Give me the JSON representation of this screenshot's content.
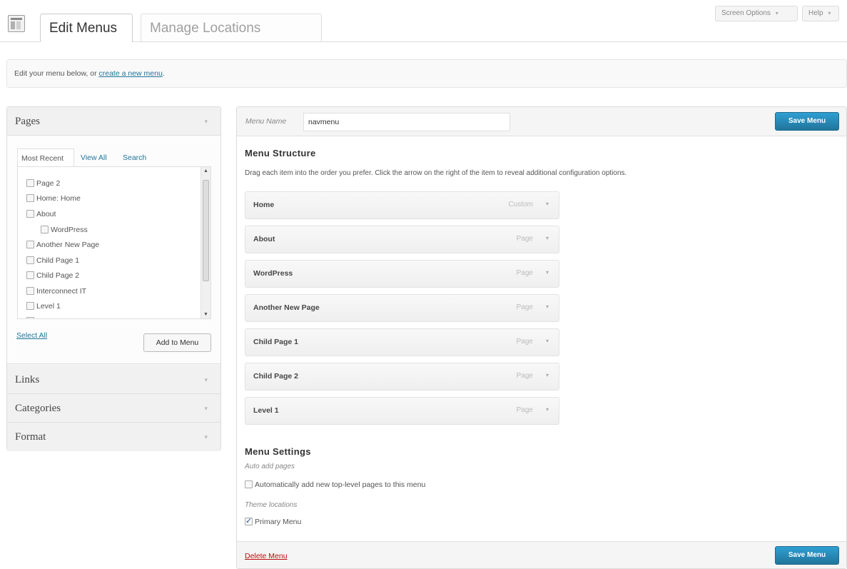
{
  "header": {
    "tabs": [
      {
        "label": "Edit Menus",
        "active": true
      },
      {
        "label": "Manage Locations",
        "active": false
      }
    ],
    "screen_options_label": "Screen Options",
    "help_label": "Help",
    "dropdown_glyph": "▾"
  },
  "notice": {
    "text": "Edit your menu below, or ",
    "link": "create a new menu",
    "suffix": "."
  },
  "sidebar": {
    "sections": [
      {
        "title": "Pages",
        "expanded": true
      },
      {
        "title": "Links",
        "expanded": false
      },
      {
        "title": "Categories",
        "expanded": false
      },
      {
        "title": "Format",
        "expanded": false
      }
    ],
    "pages_tabs": [
      "Most Recent",
      "View All",
      "Search"
    ],
    "pages": [
      {
        "label": "Page 2",
        "indent": 0
      },
      {
        "label": "Home: Home",
        "indent": 0
      },
      {
        "label": "About",
        "indent": 0
      },
      {
        "label": "WordPress",
        "indent": 1
      },
      {
        "label": "Another New Page",
        "indent": 0
      },
      {
        "label": "Child Page 1",
        "indent": 0
      },
      {
        "label": "Child Page 2",
        "indent": 0
      },
      {
        "label": "Interconnect IT",
        "indent": 0
      },
      {
        "label": "Level 1",
        "indent": 0
      }
    ],
    "select_all_label": "Select All",
    "add_to_menu_label": "Add to Menu"
  },
  "menu": {
    "name_label": "Menu Name",
    "name_value": "navmenu",
    "save_label": "Save Menu",
    "structure_title": "Menu Structure",
    "instructions": "Drag each item into the order you prefer. Click the arrow on the right of the item to reveal additional configuration options.",
    "items": [
      {
        "title": "Home",
        "type": "Custom"
      },
      {
        "title": "About",
        "type": "Page"
      },
      {
        "title": "WordPress",
        "type": "Page"
      },
      {
        "title": "Another New Page",
        "type": "Page"
      },
      {
        "title": "Child Page 1",
        "type": "Page"
      },
      {
        "title": "Child Page 2",
        "type": "Page"
      },
      {
        "title": "Level 1",
        "type": "Page"
      }
    ],
    "settings_title": "Menu Settings",
    "auto_add_label": "Auto add pages",
    "auto_add_option": "Automatically add new top-level pages to this menu",
    "auto_add_checked": false,
    "theme_locations_label": "Theme locations",
    "primary_menu_option": "Primary Menu",
    "primary_menu_checked": true,
    "delete_label": "Delete Menu"
  },
  "colors": {
    "accent": "#21759b",
    "delete": "#bc0b0b"
  }
}
